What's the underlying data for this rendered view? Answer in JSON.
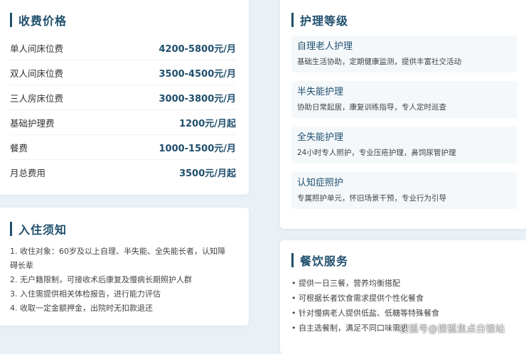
{
  "price": {
    "title": "收费价格",
    "rows": [
      {
        "label": "单人间床位费",
        "value": "4200-5800元/月"
      },
      {
        "label": "双人间床位费",
        "value": "3500-4500元/月"
      },
      {
        "label": "三人房床位费",
        "value": "3000-3800元/月"
      },
      {
        "label": "基础护理费",
        "value": "1200元/月起"
      },
      {
        "label": "餐费",
        "value": "1000-1500元/月"
      },
      {
        "label": "月总费用",
        "value": "3500元/月起"
      }
    ]
  },
  "notice": {
    "title": "入住须知",
    "items": [
      "1. 收住对象：60岁及以上自理、半失能、全失能长者，认知障碍长辈",
      "2. 无户籍限制，可接收术后康复及慢病长期照护人群",
      "3. 入住需提供相关体检报告，进行能力评估",
      "4. 收取一定金额押金，出院时无扣款退还"
    ]
  },
  "care": {
    "title": "护理等级",
    "items": [
      {
        "name": "自理老人护理",
        "desc": "基础生活协助，定期健康监测，提供丰富社交活动"
      },
      {
        "name": "半失能护理",
        "desc": "协助日常起居，康复训练指导，专人定时巡查"
      },
      {
        "name": "全失能护理",
        "desc": "24小时专人照护，专业压疮护理，鼻饲尿管护理"
      },
      {
        "name": "认知症照护",
        "desc": "专属照护单元，怀旧场景干预，专业行为引导"
      }
    ]
  },
  "food": {
    "title": "餐饮服务",
    "items": [
      "• 提供一日三餐，营养均衡搭配",
      "• 可根据长者饮食需求提供个性化餐食",
      "• 针对慢病老人提供低盐、低糖等特殊餐食",
      "• 自主选餐制，满足不同口味需求"
    ]
  },
  "watermark": "搜狐号@搜狐焦点白银站"
}
